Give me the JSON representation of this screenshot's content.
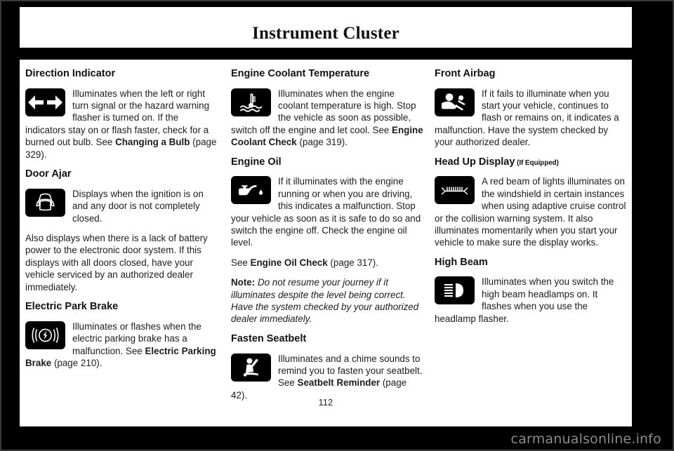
{
  "header": {
    "title": "Instrument Cluster"
  },
  "footer": {
    "page_number": "112",
    "watermark": "carmanualsonline.info"
  },
  "columns": [
    {
      "id": "column-left",
      "sections": [
        {
          "id": "direction-indicator",
          "heading": "Direction Indicator",
          "icon": "direction-indicator-icon",
          "paragraphs": [
            {
              "runs": [
                {
                  "text": "Illuminates when the left or right turn signal or the hazard warning flasher is turned on. If the indicators stay on or flash faster, check for a burned out bulb.  See ",
                  "style": "normal"
                },
                {
                  "text": "Changing a Bulb",
                  "style": "bold"
                },
                {
                  "text": " (page 329).",
                  "style": "normal"
                }
              ]
            }
          ]
        },
        {
          "id": "door-ajar",
          "heading": "Door Ajar",
          "icon": "door-ajar-icon",
          "paragraphs": [
            {
              "runs": [
                {
                  "text": "Displays when the ignition is on and any door is not completely closed.",
                  "style": "normal"
                }
              ]
            },
            {
              "runs": [
                {
                  "text": "Also displays when there is a lack of battery power to the electronic door system. If this displays with all doors closed, have your vehicle serviced by an authorized dealer immediately.",
                  "style": "normal"
                }
              ]
            }
          ]
        },
        {
          "id": "electric-park-brake",
          "heading": "Electric Park Brake",
          "icon": "electric-park-brake-icon",
          "paragraphs": [
            {
              "runs": [
                {
                  "text": "Illuminates or flashes when the electric parking brake has a malfunction.  See ",
                  "style": "normal"
                },
                {
                  "text": "Electric Parking Brake",
                  "style": "bold"
                },
                {
                  "text": " (page 210).",
                  "style": "normal"
                }
              ]
            }
          ]
        }
      ]
    },
    {
      "id": "column-middle",
      "sections": [
        {
          "id": "engine-coolant-temperature",
          "heading": "Engine Coolant Temperature",
          "icon": "engine-coolant-temperature-icon",
          "paragraphs": [
            {
              "runs": [
                {
                  "text": "Illuminates when the engine coolant temperature is high. Stop the vehicle as soon as possible, switch off the engine and let cool.  See ",
                  "style": "normal"
                },
                {
                  "text": "Engine Coolant Check",
                  "style": "bold"
                },
                {
                  "text": " (page 319).",
                  "style": "normal"
                }
              ]
            }
          ]
        },
        {
          "id": "engine-oil",
          "heading": "Engine Oil",
          "icon": "engine-oil-icon",
          "paragraphs": [
            {
              "runs": [
                {
                  "text": "If it illuminates with the engine running or when you are driving, this indicates a malfunction.  Stop your vehicle as soon as it is safe to do so and switch the engine off.  Check the engine oil level.",
                  "style": "normal"
                }
              ]
            },
            {
              "runs": [
                {
                  "text": "See ",
                  "style": "normal"
                },
                {
                  "text": "Engine Oil Check",
                  "style": "bold"
                },
                {
                  "text": " (page 317).",
                  "style": "normal"
                }
              ]
            },
            {
              "runs": [
                {
                  "text": "Note:",
                  "style": "bold"
                },
                {
                  "text": " Do not resume your journey if it illuminates despite the level being correct. Have the system checked by your authorized dealer immediately.",
                  "style": "italic"
                }
              ]
            }
          ]
        },
        {
          "id": "fasten-seatbelt",
          "heading": "Fasten Seatbelt",
          "icon": "fasten-seatbelt-icon",
          "paragraphs": [
            {
              "runs": [
                {
                  "text": "Illuminates and a chime sounds to remind you to fasten your seatbelt. See ",
                  "style": "normal"
                },
                {
                  "text": "Seatbelt Reminder",
                  "style": "bold"
                },
                {
                  "text": " (page 42).",
                  "style": "normal"
                }
              ]
            }
          ]
        }
      ]
    },
    {
      "id": "column-right",
      "sections": [
        {
          "id": "front-airbag",
          "heading": "Front Airbag",
          "icon": "front-airbag-icon",
          "paragraphs": [
            {
              "runs": [
                {
                  "text": "If it fails to illuminate when you start your vehicle, continues to flash or remains on, it indicates a malfunction. Have the system checked by your authorized dealer.",
                  "style": "normal"
                }
              ]
            }
          ]
        },
        {
          "id": "head-up-display",
          "heading": "Head Up Display",
          "heading_qualifier": "(If Equipped)",
          "icon": "head-up-display-icon",
          "paragraphs": [
            {
              "runs": [
                {
                  "text": "A red beam of lights illuminates on the windshield in certain instances when using adaptive cruise control or the collision warning system. It also illuminates momentarily when you start your vehicle to make sure the display works.",
                  "style": "normal"
                }
              ]
            }
          ]
        },
        {
          "id": "high-beam",
          "heading": "High Beam",
          "icon": "high-beam-icon",
          "paragraphs": [
            {
              "runs": [
                {
                  "text": "Illuminates when you switch the high beam headlamps on. It flashes when you use the headlamp flasher.",
                  "style": "normal"
                }
              ]
            }
          ]
        }
      ]
    }
  ],
  "colors": {
    "page_background": "#000000",
    "content_background": "#ffffff",
    "text": "#1c1c1c",
    "icon_background": "#000000",
    "icon_glyph": "#ffffff",
    "watermark": "#8c8c8c"
  }
}
